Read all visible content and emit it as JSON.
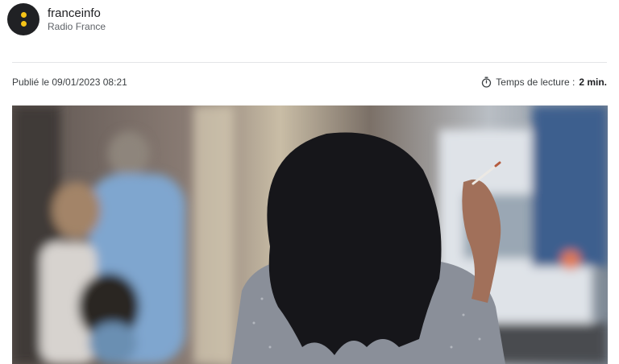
{
  "source": {
    "name": "franceinfo",
    "subtitle": "Radio France",
    "logo_colors": {
      "background": "#202124",
      "dots": "#f6c417"
    }
  },
  "article": {
    "published": "Publié le 09/01/2023 08:21",
    "reading_time_label": "Temps de lecture :",
    "reading_time_value": "2 min.",
    "reading_icon": "stopwatch-icon"
  },
  "image": {
    "icon": "photo-woman-smoking-street"
  }
}
